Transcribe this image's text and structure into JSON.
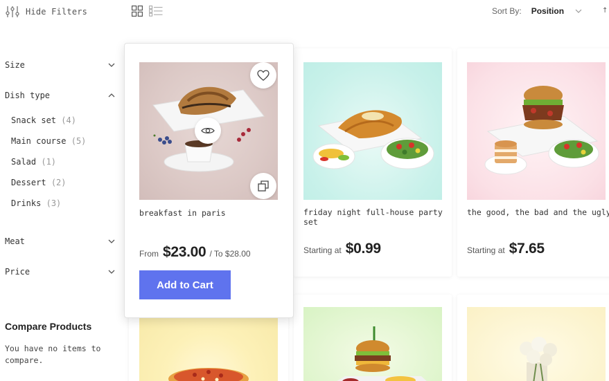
{
  "toolbar": {
    "hide_filters_label": "Hide Filters",
    "sort_by_label": "Sort By:",
    "sort_value": "Position",
    "sort_direction_glyph": "↑↓"
  },
  "sidebar": {
    "size_label": "Size",
    "dish_type_label": "Dish type",
    "dish_type_options": [
      {
        "label": "Snack set",
        "count": "(4)"
      },
      {
        "label": "Main course",
        "count": "(5)"
      },
      {
        "label": "Salad",
        "count": "(1)"
      },
      {
        "label": "Dessert",
        "count": "(2)"
      },
      {
        "label": "Drinks",
        "count": "(3)"
      }
    ],
    "meat_label": "Meat",
    "price_label": "Price",
    "compare_title": "Compare Products",
    "compare_text": "You have no items to compare."
  },
  "products": [
    {
      "name": "breakfast in paris",
      "price_prefix": "From",
      "price": "$23.00",
      "price_to": "/ To $28.00",
      "add_to_cart": "Add to Cart"
    },
    {
      "name": "friday night full-house party set",
      "price_prefix": "Starting at",
      "price": "$0.99"
    },
    {
      "name": "the good, the bad and the ugly",
      "price_prefix": "Starting at",
      "price": "$7.65"
    }
  ],
  "colors": {
    "accent": "#5f73ee",
    "card_bg_1": "#dcc9c6",
    "card_bg_2": "#c8f1ea",
    "card_bg_3": "#fbe0e6"
  }
}
